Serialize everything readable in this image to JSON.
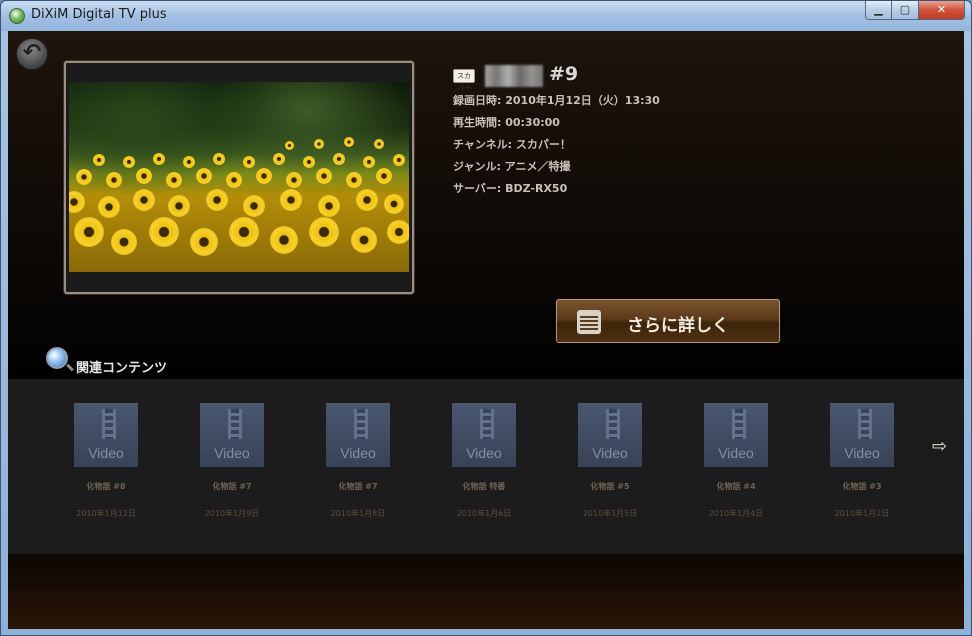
{
  "window": {
    "title": "DiXiM Digital TV plus"
  },
  "window_controls": {
    "minimize": "▁",
    "maximize": "▢",
    "close": "✕"
  },
  "detail": {
    "channel_logo_text": "スカパー",
    "episode": "#9",
    "recorded": "録画日時: 2010年1月12日（火）13:30",
    "duration": "再生時間: 00:30:00",
    "channel": "チャンネル: スカパー！",
    "genre": "ジャンル: アニメ／特撮",
    "server": "サーバー: BDZ-RX50"
  },
  "more_button": {
    "label": "さらに詳しく"
  },
  "related": {
    "heading": "関連コンテンツ",
    "items": [
      {
        "thumb_label": "Video",
        "name": "化物語 #8",
        "date": "2010年1月12日"
      },
      {
        "thumb_label": "Video",
        "name": "化物語 #7",
        "date": "2010年1月9日"
      },
      {
        "thumb_label": "Video",
        "name": "化物語 #7",
        "date": "2010年1月8日"
      },
      {
        "thumb_label": "Video",
        "name": "化物語 特番",
        "date": "2010年1月6日"
      },
      {
        "thumb_label": "Video",
        "name": "化物語 #5",
        "date": "2010年1月5日"
      },
      {
        "thumb_label": "Video",
        "name": "化物語 #4",
        "date": "2010年1月4日"
      },
      {
        "thumb_label": "Video",
        "name": "化物語 #3",
        "date": "2010年1月2日"
      }
    ]
  },
  "icons": {
    "back": "back-arrow-icon",
    "next": "next-arrow-icon",
    "related": "magnifier-icon",
    "more": "list-icon"
  }
}
